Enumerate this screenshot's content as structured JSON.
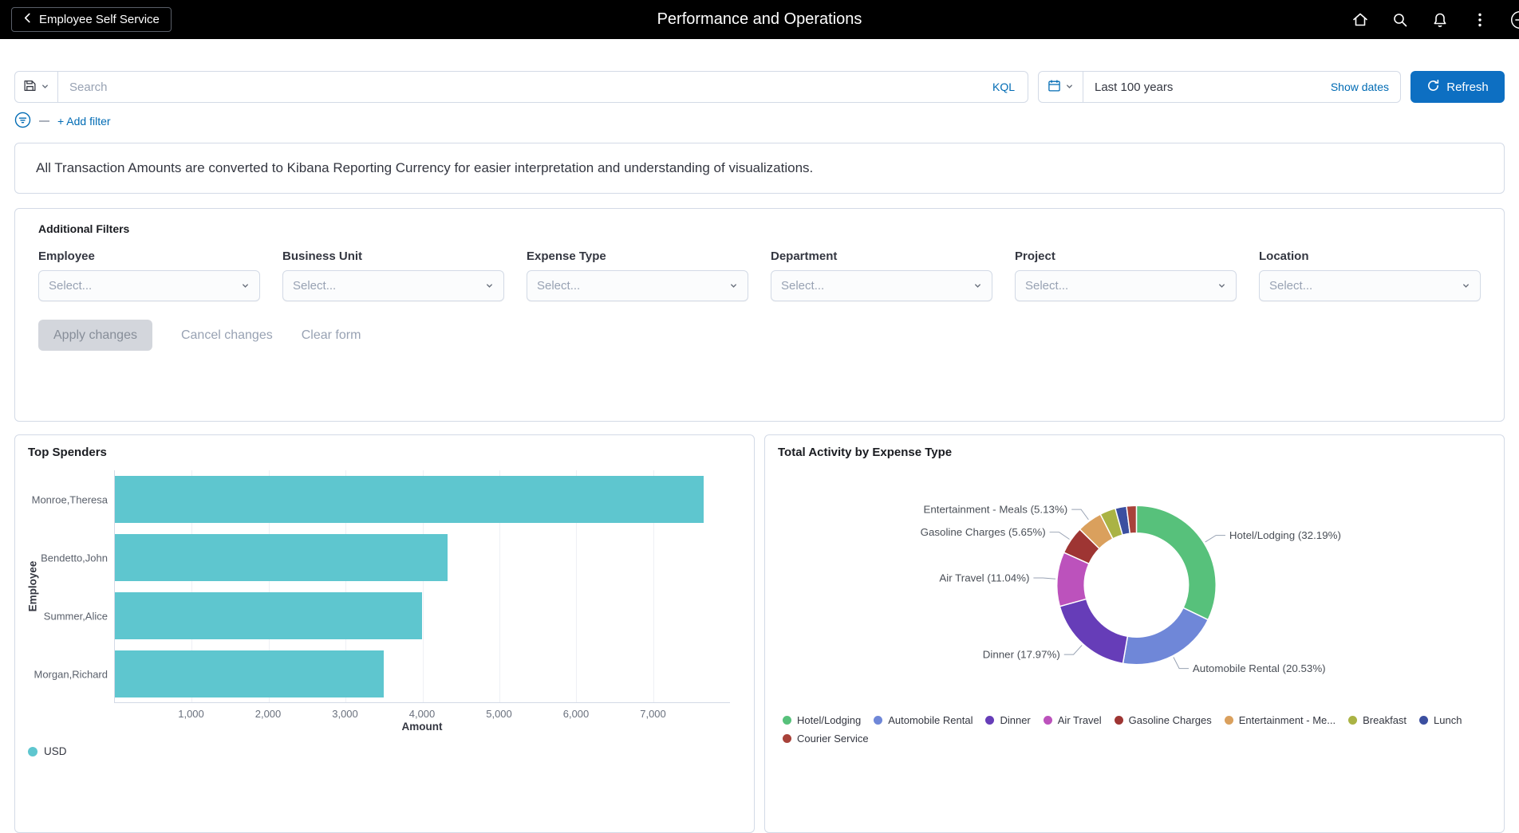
{
  "colors": {
    "header_bg": "#000000",
    "accent_blue": "#006BB4",
    "primary_button_bg": "#0D6FC2",
    "panel_border": "#D3DAE6",
    "bar_teal": "#5EC6CF"
  },
  "header": {
    "back_label": "Employee Self Service",
    "title": "Performance and Operations"
  },
  "query_bar": {
    "search_placeholder": "Search",
    "kql_label": "KQL",
    "date_range_value": "Last 100 years",
    "show_dates_label": "Show dates",
    "refresh_label": "Refresh",
    "add_filter_label": "+ Add filter"
  },
  "notice_text": "All Transaction Amounts are converted to Kibana Reporting Currency for easier interpretation and understanding of visualizations.",
  "filters_panel": {
    "title": "Additional Filters",
    "fields": [
      {
        "label": "Employee",
        "placeholder": "Select..."
      },
      {
        "label": "Business Unit",
        "placeholder": "Select..."
      },
      {
        "label": "Expense Type",
        "placeholder": "Select..."
      },
      {
        "label": "Department",
        "placeholder": "Select..."
      },
      {
        "label": "Project",
        "placeholder": "Select..."
      },
      {
        "label": "Location",
        "placeholder": "Select..."
      }
    ],
    "apply_label": "Apply changes",
    "cancel_label": "Cancel changes",
    "clear_label": "Clear form"
  },
  "chart_data": [
    {
      "type": "bar",
      "panel_title": "Top Spenders",
      "orientation": "horizontal",
      "categories": [
        "Monroe,Theresa",
        "Bendetto,John",
        "Summer,Alice",
        "Morgan,Richard"
      ],
      "values": [
        7660,
        4330,
        3990,
        3500
      ],
      "series_name": "USD",
      "color": "#5EC6CF",
      "xlabel": "Amount",
      "ylabel": "Employee",
      "xlim": [
        0,
        8000
      ],
      "xticks": [
        1000,
        2000,
        3000,
        4000,
        5000,
        6000,
        7000
      ],
      "grid": true,
      "legend_position": "bottom-left"
    },
    {
      "type": "pie",
      "panel_title": "Total Activity by Expense Type",
      "donut": true,
      "legend_position": "bottom",
      "slices": [
        {
          "label": "Hotel/Lodging",
          "percent": 32.19,
          "color": "#57C17B",
          "callout": true
        },
        {
          "label": "Automobile Rental",
          "percent": 20.53,
          "color": "#6F87D8",
          "callout": true
        },
        {
          "label": "Dinner",
          "percent": 17.97,
          "color": "#663DB8",
          "callout": true
        },
        {
          "label": "Air Travel",
          "percent": 11.04,
          "color": "#BC52BC",
          "callout": true
        },
        {
          "label": "Gasoline Charges",
          "percent": 5.65,
          "color": "#9E3533",
          "callout": true
        },
        {
          "label": "Entertainment - Meals",
          "percent": 5.13,
          "color": "#DAA05D",
          "callout": true,
          "legend_label": "Entertainment - Me..."
        },
        {
          "label": "Breakfast",
          "percent": 3.2,
          "color": "#AAB344",
          "callout": false
        },
        {
          "label": "Lunch",
          "percent": 2.3,
          "color": "#3B4FA0",
          "callout": false
        },
        {
          "label": "Courier Service",
          "percent": 1.99,
          "color": "#A8423A",
          "callout": false
        }
      ]
    }
  ]
}
